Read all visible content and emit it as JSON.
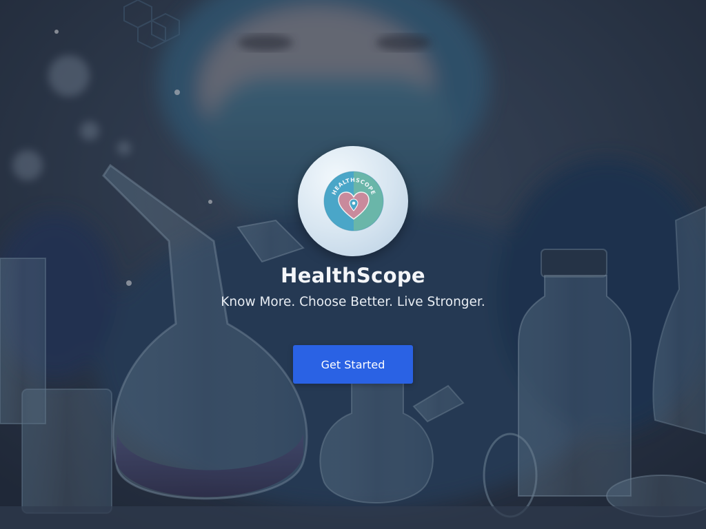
{
  "app": {
    "title": "HealthScope",
    "tagline": "Know More. Choose Better. Live Stronger."
  },
  "logo": {
    "badge_text": "HEALTHSCOPE",
    "icon": "heart-location-pin-icon"
  },
  "cta": {
    "label": "Get Started"
  },
  "background": {
    "description_icon": "laboratory-scientist-background"
  },
  "colors": {
    "accent": "#2a62e4",
    "overlay": "#1e2b3d",
    "heart": "#c98a9c",
    "badge_teal": "#5aa9c4"
  }
}
